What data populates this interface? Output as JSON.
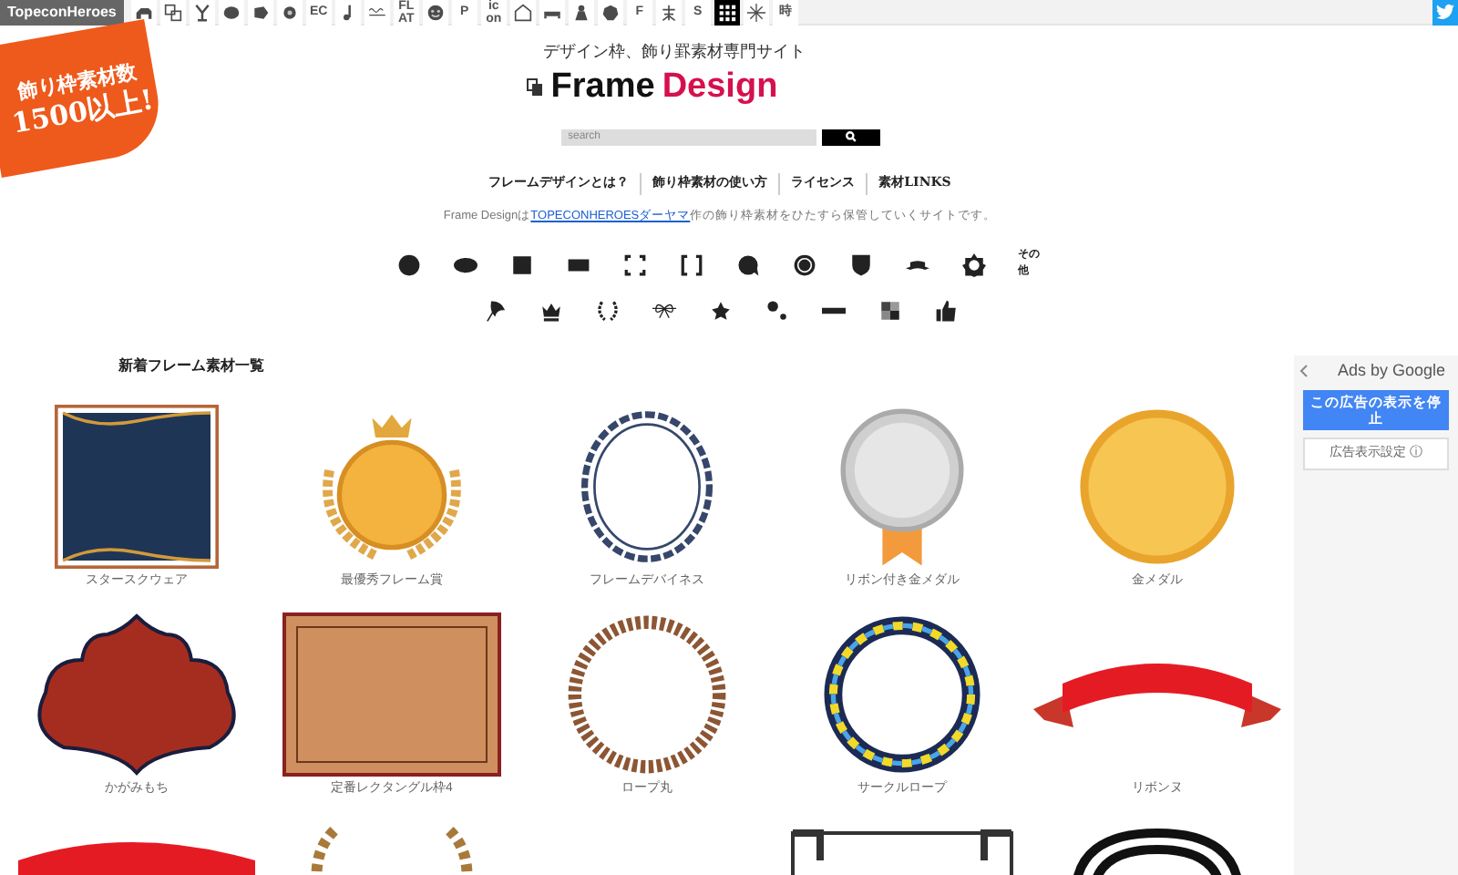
{
  "top_bar": {
    "logo": "TopeconHeroes",
    "items": [
      {
        "kind": "icon",
        "selected": false
      },
      {
        "kind": "icon",
        "selected": false
      },
      {
        "kind": "icon",
        "selected": false
      },
      {
        "kind": "icon",
        "selected": false
      },
      {
        "kind": "icon",
        "selected": false
      },
      {
        "kind": "icon",
        "selected": false
      },
      {
        "kind": "text",
        "label": "EC",
        "selected": false
      },
      {
        "kind": "icon",
        "selected": false
      },
      {
        "kind": "icon",
        "selected": false
      },
      {
        "kind": "text",
        "label": "FL AT",
        "selected": false
      },
      {
        "kind": "icon",
        "selected": false
      },
      {
        "kind": "text",
        "label": "P",
        "selected": false
      },
      {
        "kind": "text",
        "label": "ic on",
        "selected": false
      },
      {
        "kind": "icon",
        "selected": false
      },
      {
        "kind": "icon",
        "selected": false
      },
      {
        "kind": "icon",
        "selected": false
      },
      {
        "kind": "icon",
        "selected": false
      },
      {
        "kind": "text",
        "label": "F",
        "selected": false
      },
      {
        "kind": "icon",
        "selected": false
      },
      {
        "kind": "text",
        "label": "S",
        "selected": false
      },
      {
        "kind": "icon",
        "selected": true
      },
      {
        "kind": "icon",
        "selected": false
      },
      {
        "kind": "text",
        "label": "時",
        "selected": false
      }
    ]
  },
  "corner_badge": {
    "line_1": "飾り枠素材数",
    "line_2": "1500以上!"
  },
  "header": {
    "tagline": "デザイン枠、飾り罫素材専門サイト",
    "logo_part_1": "Frame",
    "logo_part_2": "Design"
  },
  "search": {
    "placeholder": "search"
  },
  "nav": [
    "フレームデザインとは？",
    "飾り枠素材の使い方",
    "ライセンス",
    "素材LINKS"
  ],
  "description": {
    "before": "Frame Designは",
    "link": "TOPECONHEROESダーヤマ",
    "after": "作の飾り枠素材をひたすら保管していくサイトです。"
  },
  "categories": [
    [
      {
        "kind": "icon"
      },
      {
        "kind": "icon"
      },
      {
        "kind": "icon"
      },
      {
        "kind": "icon"
      },
      {
        "kind": "icon"
      },
      {
        "kind": "icon"
      },
      {
        "kind": "icon"
      },
      {
        "kind": "icon"
      },
      {
        "kind": "icon"
      },
      {
        "kind": "icon"
      },
      {
        "kind": "icon"
      },
      {
        "kind": "text",
        "label": "その他"
      }
    ],
    [
      {
        "kind": "icon"
      },
      {
        "kind": "icon"
      },
      {
        "kind": "icon"
      },
      {
        "kind": "icon"
      },
      {
        "kind": "icon"
      },
      {
        "kind": "icon"
      },
      {
        "kind": "icon"
      },
      {
        "kind": "icon"
      },
      {
        "kind": "icon"
      }
    ]
  ],
  "section_title": "新着フレーム素材一覧",
  "frames": [
    {
      "label": "スタースクウェア"
    },
    {
      "label": "最優秀フレーム賞"
    },
    {
      "label": "フレームデバイネス"
    },
    {
      "label": "リボン付き金メダル"
    },
    {
      "label": "金メダル"
    },
    {
      "label": "かがみもち"
    },
    {
      "label": "定番レクタングル枠4"
    },
    {
      "label": "ロープ丸"
    },
    {
      "label": "サークルロープ"
    },
    {
      "label": "リボンヌ"
    }
  ],
  "ads": {
    "header": "Ads by Google",
    "stop_button": "この広告の表示を停止",
    "settings_button": "広告表示設定 ⓘ"
  }
}
